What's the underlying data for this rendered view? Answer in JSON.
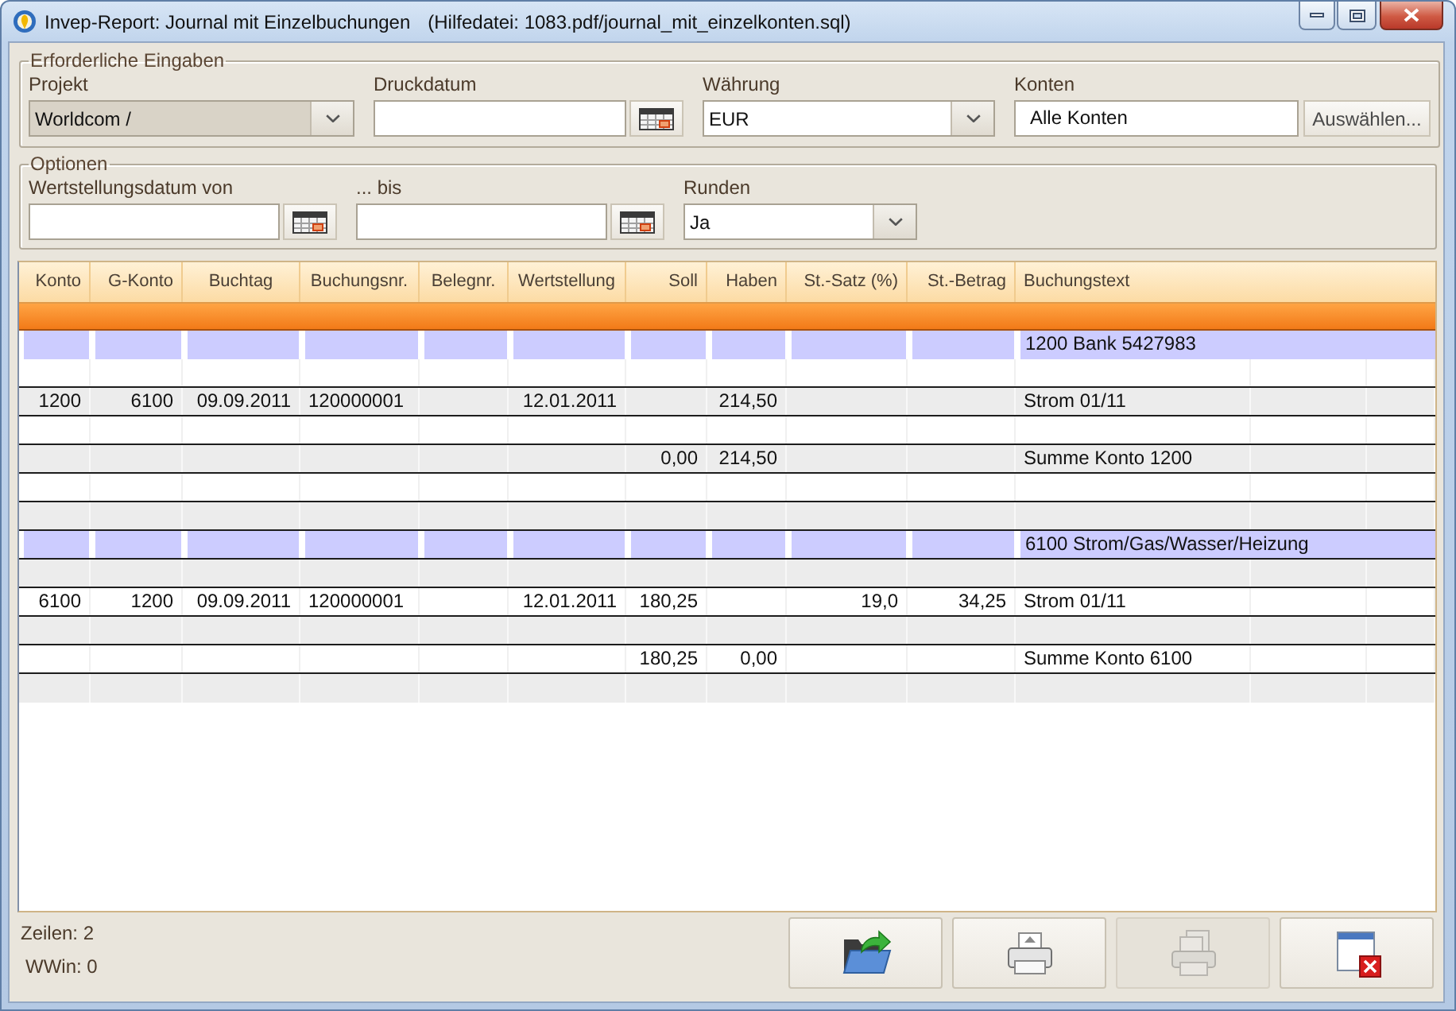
{
  "window": {
    "title": "Invep-Report: Journal mit Einzelbuchungen",
    "subtitle": "(Hilfedatei: 1083.pdf/journal_mit_einzelkonten.sql)"
  },
  "required_inputs": {
    "legend": "Erforderliche Eingaben",
    "fields": [
      {
        "kind": "combo",
        "label": "Projekt",
        "value": "Worldcom /",
        "editable": false
      },
      {
        "kind": "date",
        "label": "Druckdatum",
        "editable": true
      },
      {
        "kind": "combo",
        "label": "Währung",
        "value": "EUR",
        "editable": true
      },
      {
        "kind": "picker",
        "label": "Konten",
        "value": "Alle Konten",
        "button": "Auswählen...",
        "editable": true
      }
    ]
  },
  "options": {
    "legend": "Optionen",
    "fields": [
      {
        "kind": "date",
        "label": "Wertstellungsdatum von",
        "editable": true
      },
      {
        "kind": "date",
        "label": "... bis",
        "editable": true
      },
      {
        "kind": "combo",
        "label": "Runden",
        "value": "Ja",
        "editable": true
      }
    ]
  },
  "table": {
    "columns": [
      "Konto",
      "G-Konto",
      "Buchtag",
      "Buchungsnr.",
      "Belegnr.",
      "Wertstellung",
      "Soll",
      "Haben",
      "St.-Satz (%)",
      "St.-Betrag",
      "Buchungstext"
    ],
    "rows": [
      {
        "kind": "group",
        "buchungstext": "1200 Bank 5427983"
      },
      {
        "kind": "line"
      },
      {
        "kind": "line",
        "konto": "1200",
        "g_konto": "6100",
        "buchtag": "09.09.2011",
        "buchungsnr": "120000001",
        "wertstellung": "12.01.2011",
        "haben": "214,50",
        "buchungstext": "Strom 01/11"
      },
      {
        "kind": "line"
      },
      {
        "kind": "line",
        "soll": "0,00",
        "haben": "214,50",
        "buchungstext": "Summe Konto 1200"
      },
      {
        "kind": "line"
      },
      {
        "kind": "line"
      },
      {
        "kind": "group",
        "buchungstext": "6100 Strom/Gas/Wasser/Heizung"
      },
      {
        "kind": "line"
      },
      {
        "kind": "line",
        "konto": "6100",
        "g_konto": "1200",
        "buchtag": "09.09.2011",
        "buchungsnr": "120000001",
        "wertstellung": "12.01.2011",
        "soll": "180,25",
        "st_satz": "19,0",
        "st_betrag": "34,25",
        "buchungstext": "Strom 01/11"
      },
      {
        "kind": "line"
      },
      {
        "kind": "line",
        "soll": "180,25",
        "haben": "0,00",
        "buchungstext": "Summe Konto 6100"
      },
      {
        "kind": "line"
      }
    ]
  },
  "status_bar": [
    "Zeilen: 2",
    "WWin: 0"
  ],
  "buttons": [
    {
      "kind": "export",
      "disabled": false
    },
    {
      "kind": "print",
      "disabled": false
    },
    {
      "kind": "preview",
      "disabled": true
    },
    {
      "kind": "close",
      "disabled": false
    }
  ]
}
